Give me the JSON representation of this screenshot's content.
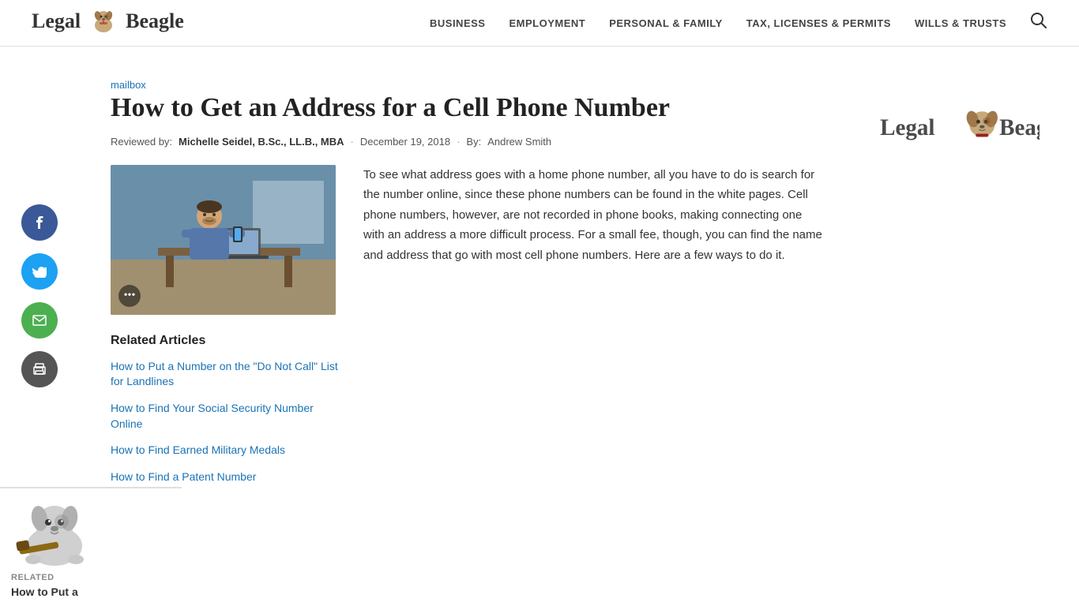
{
  "site": {
    "name_part1": "Legal",
    "name_part2": "Beagle"
  },
  "nav": {
    "items": [
      {
        "label": "BUSINESS",
        "href": "#"
      },
      {
        "label": "EMPLOYMENT",
        "href": "#"
      },
      {
        "label": "PERSONAL & FAMILY",
        "href": "#"
      },
      {
        "label": "TAX, LICENSES & PERMITS",
        "href": "#"
      },
      {
        "label": "WILLS & TRUSTS",
        "href": "#"
      }
    ]
  },
  "article": {
    "breadcrumb": "mailbox",
    "title": "How to Get an Address for a Cell Phone Number",
    "meta": {
      "reviewed_by_label": "Reviewed by:",
      "reviewer": "Michelle Seidel, B.Sc., LL.B., MBA",
      "separator": "·",
      "date": "December 19, 2018",
      "by_label": "By:",
      "author": "Andrew Smith"
    },
    "body_text": "To see what address goes with a home phone number, all you have to do is search for the number online, since these phone numbers can be found in the white pages. Cell phone numbers, however, are not recorded in phone books, making connecting one with an address a more difficult process. For a small fee, though, you can find the name and address that go with most cell phone numbers. Here are a few ways to do it.",
    "related_articles": {
      "heading": "Related Articles",
      "items": [
        {
          "label": "How to Put a Number on the \"Do Not Call\" List for Landlines",
          "href": "#"
        },
        {
          "label": "How to Find Your Social Security Number Online",
          "href": "#"
        },
        {
          "label": "How to Find Earned Military Medals",
          "href": "#"
        },
        {
          "label": "How to Find a Patent Number",
          "href": "#"
        }
      ]
    }
  },
  "social": {
    "facebook_label": "f",
    "twitter_label": "t",
    "email_label": "✉",
    "print_label": "🖨"
  },
  "bottom_related": {
    "label": "RELATED",
    "text": "How to Put a"
  }
}
